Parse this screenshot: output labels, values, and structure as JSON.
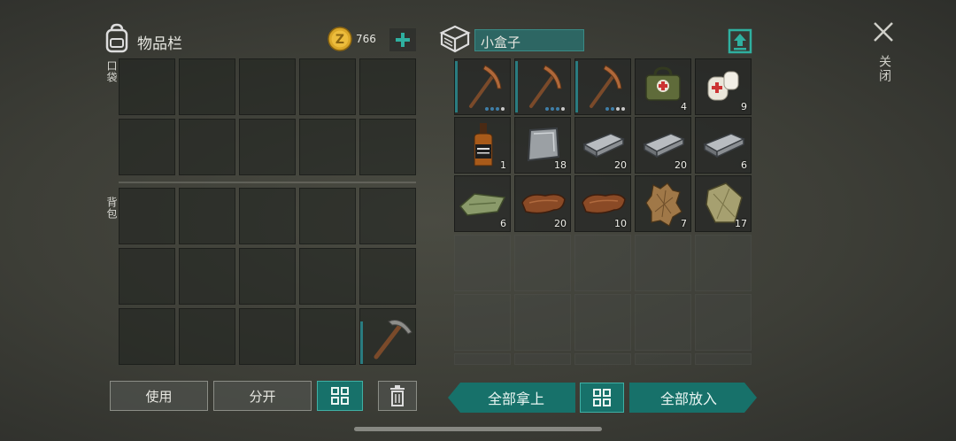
{
  "inventory": {
    "title": "物品栏",
    "coins": "766",
    "pocket_label": "口袋",
    "backpack_label": "背包",
    "use_label": "使用",
    "split_label": "分开"
  },
  "container": {
    "name": "小盒子",
    "take_all_label": "全部拿上",
    "put_all_label": "全部放入",
    "items": [
      {
        "name": "pickaxe-icon",
        "count": ""
      },
      {
        "name": "pickaxe-icon",
        "count": ""
      },
      {
        "name": "pickaxe-icon",
        "count": ""
      },
      {
        "name": "medkit-icon",
        "count": "4"
      },
      {
        "name": "bandage-icon",
        "count": "9"
      },
      {
        "name": "whiskey-bottle-icon",
        "count": "1"
      },
      {
        "name": "metal-plate-icon",
        "count": "18"
      },
      {
        "name": "iron-ingot-icon",
        "count": "20"
      },
      {
        "name": "iron-ingot-icon",
        "count": "20"
      },
      {
        "name": "iron-ingot-icon",
        "count": "6"
      },
      {
        "name": "cloth-icon",
        "count": "6"
      },
      {
        "name": "leather-icon",
        "count": "20"
      },
      {
        "name": "leather-icon",
        "count": "10"
      },
      {
        "name": "fur-icon",
        "count": "7"
      },
      {
        "name": "burlap-sack-icon",
        "count": "17"
      }
    ]
  },
  "close_label": "关闭",
  "colors": {
    "accent": "#17716a",
    "highlight": "#2fa89d"
  }
}
